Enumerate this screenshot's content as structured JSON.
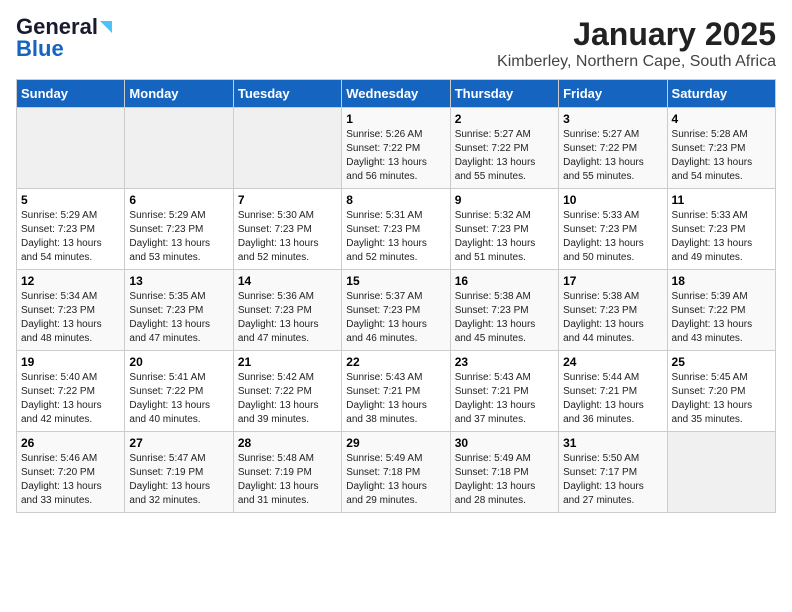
{
  "logo": {
    "line1": "General",
    "line2": "Blue"
  },
  "title": "January 2025",
  "subtitle": "Kimberley, Northern Cape, South Africa",
  "days_of_week": [
    "Sunday",
    "Monday",
    "Tuesday",
    "Wednesday",
    "Thursday",
    "Friday",
    "Saturday"
  ],
  "weeks": [
    [
      {
        "day": "",
        "sunrise": "",
        "sunset": "",
        "daylight": ""
      },
      {
        "day": "",
        "sunrise": "",
        "sunset": "",
        "daylight": ""
      },
      {
        "day": "",
        "sunrise": "",
        "sunset": "",
        "daylight": ""
      },
      {
        "day": "1",
        "sunrise": "Sunrise: 5:26 AM",
        "sunset": "Sunset: 7:22 PM",
        "daylight": "Daylight: 13 hours and 56 minutes."
      },
      {
        "day": "2",
        "sunrise": "Sunrise: 5:27 AM",
        "sunset": "Sunset: 7:22 PM",
        "daylight": "Daylight: 13 hours and 55 minutes."
      },
      {
        "day": "3",
        "sunrise": "Sunrise: 5:27 AM",
        "sunset": "Sunset: 7:22 PM",
        "daylight": "Daylight: 13 hours and 55 minutes."
      },
      {
        "day": "4",
        "sunrise": "Sunrise: 5:28 AM",
        "sunset": "Sunset: 7:23 PM",
        "daylight": "Daylight: 13 hours and 54 minutes."
      }
    ],
    [
      {
        "day": "5",
        "sunrise": "Sunrise: 5:29 AM",
        "sunset": "Sunset: 7:23 PM",
        "daylight": "Daylight: 13 hours and 54 minutes."
      },
      {
        "day": "6",
        "sunrise": "Sunrise: 5:29 AM",
        "sunset": "Sunset: 7:23 PM",
        "daylight": "Daylight: 13 hours and 53 minutes."
      },
      {
        "day": "7",
        "sunrise": "Sunrise: 5:30 AM",
        "sunset": "Sunset: 7:23 PM",
        "daylight": "Daylight: 13 hours and 52 minutes."
      },
      {
        "day": "8",
        "sunrise": "Sunrise: 5:31 AM",
        "sunset": "Sunset: 7:23 PM",
        "daylight": "Daylight: 13 hours and 52 minutes."
      },
      {
        "day": "9",
        "sunrise": "Sunrise: 5:32 AM",
        "sunset": "Sunset: 7:23 PM",
        "daylight": "Daylight: 13 hours and 51 minutes."
      },
      {
        "day": "10",
        "sunrise": "Sunrise: 5:33 AM",
        "sunset": "Sunset: 7:23 PM",
        "daylight": "Daylight: 13 hours and 50 minutes."
      },
      {
        "day": "11",
        "sunrise": "Sunrise: 5:33 AM",
        "sunset": "Sunset: 7:23 PM",
        "daylight": "Daylight: 13 hours and 49 minutes."
      }
    ],
    [
      {
        "day": "12",
        "sunrise": "Sunrise: 5:34 AM",
        "sunset": "Sunset: 7:23 PM",
        "daylight": "Daylight: 13 hours and 48 minutes."
      },
      {
        "day": "13",
        "sunrise": "Sunrise: 5:35 AM",
        "sunset": "Sunset: 7:23 PM",
        "daylight": "Daylight: 13 hours and 47 minutes."
      },
      {
        "day": "14",
        "sunrise": "Sunrise: 5:36 AM",
        "sunset": "Sunset: 7:23 PM",
        "daylight": "Daylight: 13 hours and 47 minutes."
      },
      {
        "day": "15",
        "sunrise": "Sunrise: 5:37 AM",
        "sunset": "Sunset: 7:23 PM",
        "daylight": "Daylight: 13 hours and 46 minutes."
      },
      {
        "day": "16",
        "sunrise": "Sunrise: 5:38 AM",
        "sunset": "Sunset: 7:23 PM",
        "daylight": "Daylight: 13 hours and 45 minutes."
      },
      {
        "day": "17",
        "sunrise": "Sunrise: 5:38 AM",
        "sunset": "Sunset: 7:23 PM",
        "daylight": "Daylight: 13 hours and 44 minutes."
      },
      {
        "day": "18",
        "sunrise": "Sunrise: 5:39 AM",
        "sunset": "Sunset: 7:22 PM",
        "daylight": "Daylight: 13 hours and 43 minutes."
      }
    ],
    [
      {
        "day": "19",
        "sunrise": "Sunrise: 5:40 AM",
        "sunset": "Sunset: 7:22 PM",
        "daylight": "Daylight: 13 hours and 42 minutes."
      },
      {
        "day": "20",
        "sunrise": "Sunrise: 5:41 AM",
        "sunset": "Sunset: 7:22 PM",
        "daylight": "Daylight: 13 hours and 40 minutes."
      },
      {
        "day": "21",
        "sunrise": "Sunrise: 5:42 AM",
        "sunset": "Sunset: 7:22 PM",
        "daylight": "Daylight: 13 hours and 39 minutes."
      },
      {
        "day": "22",
        "sunrise": "Sunrise: 5:43 AM",
        "sunset": "Sunset: 7:21 PM",
        "daylight": "Daylight: 13 hours and 38 minutes."
      },
      {
        "day": "23",
        "sunrise": "Sunrise: 5:43 AM",
        "sunset": "Sunset: 7:21 PM",
        "daylight": "Daylight: 13 hours and 37 minutes."
      },
      {
        "day": "24",
        "sunrise": "Sunrise: 5:44 AM",
        "sunset": "Sunset: 7:21 PM",
        "daylight": "Daylight: 13 hours and 36 minutes."
      },
      {
        "day": "25",
        "sunrise": "Sunrise: 5:45 AM",
        "sunset": "Sunset: 7:20 PM",
        "daylight": "Daylight: 13 hours and 35 minutes."
      }
    ],
    [
      {
        "day": "26",
        "sunrise": "Sunrise: 5:46 AM",
        "sunset": "Sunset: 7:20 PM",
        "daylight": "Daylight: 13 hours and 33 minutes."
      },
      {
        "day": "27",
        "sunrise": "Sunrise: 5:47 AM",
        "sunset": "Sunset: 7:19 PM",
        "daylight": "Daylight: 13 hours and 32 minutes."
      },
      {
        "day": "28",
        "sunrise": "Sunrise: 5:48 AM",
        "sunset": "Sunset: 7:19 PM",
        "daylight": "Daylight: 13 hours and 31 minutes."
      },
      {
        "day": "29",
        "sunrise": "Sunrise: 5:49 AM",
        "sunset": "Sunset: 7:18 PM",
        "daylight": "Daylight: 13 hours and 29 minutes."
      },
      {
        "day": "30",
        "sunrise": "Sunrise: 5:49 AM",
        "sunset": "Sunset: 7:18 PM",
        "daylight": "Daylight: 13 hours and 28 minutes."
      },
      {
        "day": "31",
        "sunrise": "Sunrise: 5:50 AM",
        "sunset": "Sunset: 7:17 PM",
        "daylight": "Daylight: 13 hours and 27 minutes."
      },
      {
        "day": "",
        "sunrise": "",
        "sunset": "",
        "daylight": ""
      }
    ]
  ]
}
